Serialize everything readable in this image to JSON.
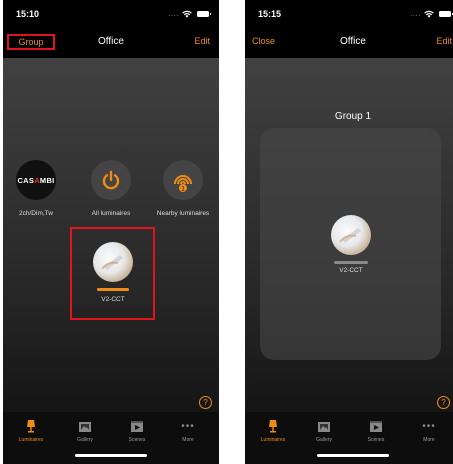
{
  "left_screen": {
    "status": {
      "time": "15:10",
      "signal": "...."
    },
    "nav": {
      "left": "Group",
      "title": "Office",
      "right": "Edit"
    },
    "tiles": [
      {
        "label": "2ch/Dim,Tw",
        "logo_text_a": "CAS",
        "logo_text_accent": "A",
        "logo_text_b": "MBI"
      },
      {
        "label": "All luminaires"
      },
      {
        "label": "Nearby luminaires",
        "badge": "1"
      },
      {
        "label": "V2-CCT",
        "level": 1.0
      }
    ],
    "help": "?"
  },
  "right_screen": {
    "status": {
      "time": "15:15",
      "signal": "...."
    },
    "nav": {
      "left": "Close",
      "title": "Office",
      "right": "Edit"
    },
    "group_title": "Group 1",
    "tile": {
      "label": "V2-CCT"
    },
    "help": "?"
  },
  "tabbar": {
    "items": [
      {
        "label": "Luminaires",
        "icon": "lamp-icon",
        "active": true
      },
      {
        "label": "Gallery",
        "icon": "gallery-icon",
        "active": false
      },
      {
        "label": "Scenes",
        "icon": "scenes-icon",
        "active": false
      },
      {
        "label": "More",
        "icon": "more-icon",
        "active": false
      }
    ]
  },
  "colors": {
    "accent": "#f08c14",
    "highlight": "#e0141e",
    "casambi_accent": "#e53222"
  }
}
